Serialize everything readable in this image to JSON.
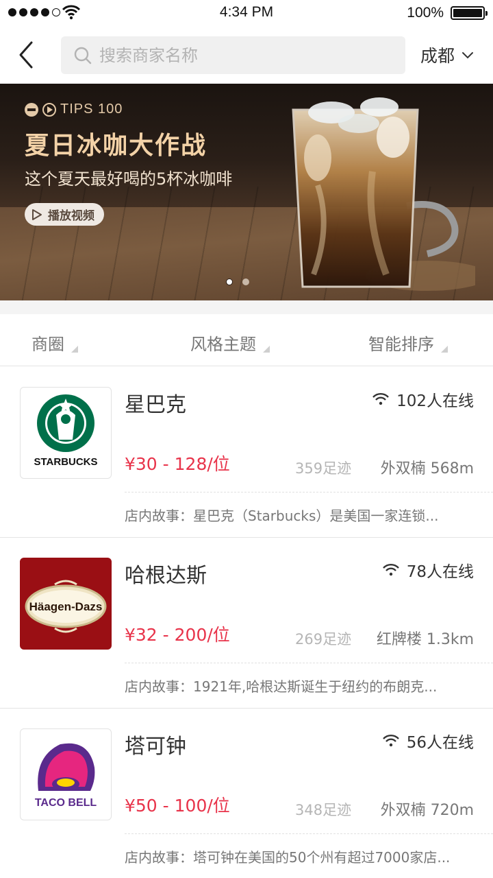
{
  "status_bar": {
    "time": "4:34 PM",
    "battery": "100%"
  },
  "nav": {
    "search_placeholder": "搜索商家名称",
    "city": "成都"
  },
  "banner": {
    "tag": "TIPS 100",
    "title": "夏日冰咖大作战",
    "subtitle": "这个夏天最好喝的5杯冰咖啡",
    "play_label": "播放视频"
  },
  "filters": [
    {
      "label": "商圈"
    },
    {
      "label": "风格主题"
    },
    {
      "label": "智能排序"
    }
  ],
  "stores": [
    {
      "name": "星巴克",
      "online": "102人在线",
      "price": "¥30 - 128/位",
      "footprints": "359足迹",
      "location": "外双楠 568m",
      "story": "店内故事：星巴克（Starbucks）是美国一家连锁...",
      "logo": "starbucks-logo"
    },
    {
      "name": "哈根达斯",
      "online": "78人在线",
      "price": "¥32 - 200/位",
      "footprints": "269足迹",
      "location": "红牌楼 1.3km",
      "story": "店内故事：1921年,哈根达斯诞生于纽约的布朗克...",
      "logo": "haagen-dazs-logo",
      "logo_text": "Häagen-Dazs"
    },
    {
      "name": "塔可钟",
      "online": "56人在线",
      "price": "¥50 - 100/位",
      "footprints": "348足迹",
      "location": "外双楠 720m",
      "story": "店内故事：塔可钟在美国的50个州有超过7000家店...",
      "logo": "taco-bell-logo",
      "logo_text": "TACO BELL"
    }
  ],
  "colors": {
    "price": "#e8334a",
    "search_bg": "#f0f0f0",
    "banner_title": "#f3d2a7"
  }
}
